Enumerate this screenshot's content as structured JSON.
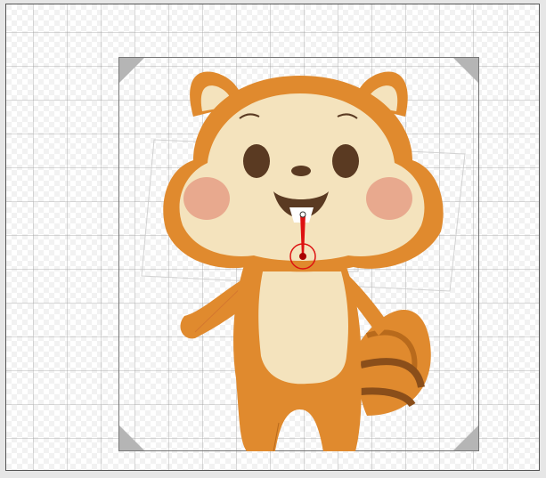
{
  "editor": {
    "canvas_name": "squirrel-character",
    "background": "transparent-checkerboard-grid"
  },
  "character": {
    "name": "squirrel",
    "colors": {
      "fur": "#e08a2e",
      "fur_dark": "#b86a1c",
      "face": "#f4e3bd",
      "cheek": "#e8a98e",
      "eye": "#5a3a22",
      "tail_stripe": "#8a4e1a"
    }
  },
  "rig": {
    "bones": [
      "head",
      "left-arm",
      "right-arm",
      "body",
      "tail"
    ],
    "selected_bone": "head",
    "pivot_color": "#dd1111"
  },
  "icons": {
    "pivot": "pivot-circle-icon",
    "bone": "bone-icon"
  }
}
